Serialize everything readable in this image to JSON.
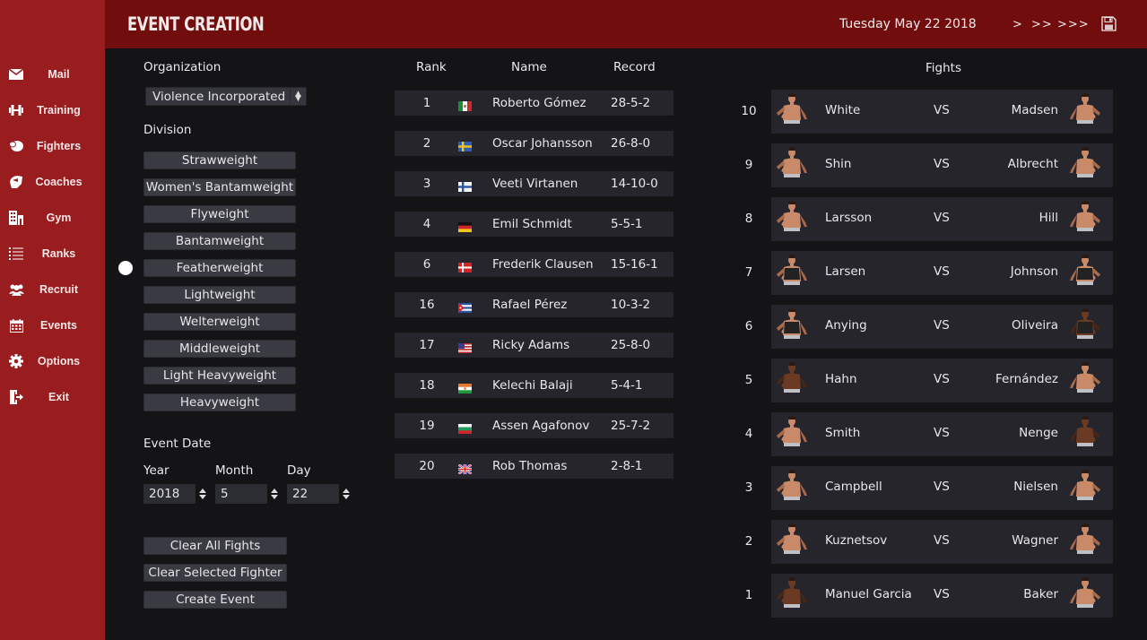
{
  "header": {
    "title": "Event Creation",
    "date": "Tuesday May 22 2018",
    "advance": [
      ">",
      ">>",
      ">>>"
    ],
    "save_icon": "floppy-disk-icon"
  },
  "sidebar": {
    "items": [
      {
        "label": "Mail",
        "icon": "envelope-icon"
      },
      {
        "label": "Training",
        "icon": "dumbbell-icon"
      },
      {
        "label": "Fighters",
        "icon": "boxing-glove-icon"
      },
      {
        "label": "Coaches",
        "icon": "whistle-icon"
      },
      {
        "label": "Gym",
        "icon": "building-icon"
      },
      {
        "label": "Ranks",
        "icon": "list-icon"
      },
      {
        "label": "Recruit",
        "icon": "users-icon"
      },
      {
        "label": "Events",
        "icon": "calendar-icon"
      },
      {
        "label": "Options",
        "icon": "gear-icon"
      },
      {
        "label": "Exit",
        "icon": "exit-door-icon"
      }
    ]
  },
  "left": {
    "organization_label": "Organization",
    "organization_value": "Violence Incorporated",
    "division_label": "Division",
    "divisions": [
      "Strawweight",
      "Women's Bantamweight",
      "Flyweight",
      "Bantamweight",
      "Featherweight",
      "Lightweight",
      "Welterweight",
      "Middleweight",
      "Light Heavyweight",
      "Heavyweight"
    ],
    "selected_division": "Featherweight",
    "event_date_label": "Event Date",
    "year_label": "Year",
    "month_label": "Month",
    "day_label": "Day",
    "year": "2018",
    "month": "5",
    "day": "22",
    "buttons": {
      "clear_all": "Clear All Fights",
      "clear_selected": "Clear Selected Fighter",
      "create": "Create Event"
    }
  },
  "ranks": {
    "headers": {
      "rank": "Rank",
      "name": "Name",
      "record": "Record"
    },
    "rows": [
      {
        "rank": "1",
        "country": "Mexico",
        "name": "Roberto Gómez",
        "record": "28-5-2"
      },
      {
        "rank": "2",
        "country": "Sweden",
        "name": "Oscar Johansson",
        "record": "26-8-0"
      },
      {
        "rank": "3",
        "country": "Finland",
        "name": "Veeti Virtanen",
        "record": "14-10-0"
      },
      {
        "rank": "4",
        "country": "Germany",
        "name": "Emil Schmidt",
        "record": "5-5-1"
      },
      {
        "rank": "6",
        "country": "Denmark",
        "name": "Frederik Clausen",
        "record": "15-16-1"
      },
      {
        "rank": "16",
        "country": "Cuba",
        "name": "Rafael Pérez",
        "record": "10-3-2"
      },
      {
        "rank": "17",
        "country": "United States",
        "name": "Ricky Adams",
        "record": "25-8-0"
      },
      {
        "rank": "18",
        "country": "Niger",
        "name": "Kelechi Balaji",
        "record": "5-4-1"
      },
      {
        "rank": "19",
        "country": "Bulgaria",
        "name": "Assen Agafonov",
        "record": "25-7-2"
      },
      {
        "rank": "20",
        "country": "United Kingdom",
        "name": "Rob Thomas",
        "record": "2-8-1"
      }
    ]
  },
  "fights": {
    "title": "Fights",
    "vs_label": "VS",
    "rows": [
      {
        "num": "10",
        "left": "White",
        "right": "Madsen",
        "left_skin": "light",
        "right_skin": "light",
        "left_f": false,
        "right_f": false
      },
      {
        "num": "9",
        "left": "Shin",
        "right": "Albrecht",
        "left_skin": "light",
        "right_skin": "light",
        "left_f": false,
        "right_f": false
      },
      {
        "num": "8",
        "left": "Larsson",
        "right": "Hill",
        "left_skin": "light",
        "right_skin": "light",
        "left_f": false,
        "right_f": false
      },
      {
        "num": "7",
        "left": "Larsen",
        "right": "Johnson",
        "left_skin": "light",
        "right_skin": "light",
        "left_f": true,
        "right_f": true
      },
      {
        "num": "6",
        "left": "Anying",
        "right": "Oliveira",
        "left_skin": "light",
        "right_skin": "dark",
        "left_f": true,
        "right_f": true
      },
      {
        "num": "5",
        "left": "Hahn",
        "right": "Fernández",
        "left_skin": "dark",
        "right_skin": "light",
        "left_f": false,
        "right_f": false
      },
      {
        "num": "4",
        "left": "Smith",
        "right": "Nenge",
        "left_skin": "light",
        "right_skin": "dark",
        "left_f": false,
        "right_f": false
      },
      {
        "num": "3",
        "left": "Campbell",
        "right": "Nielsen",
        "left_skin": "light",
        "right_skin": "light",
        "left_f": false,
        "right_f": false
      },
      {
        "num": "2",
        "left": "Kuznetsov",
        "right": "Wagner",
        "left_skin": "light",
        "right_skin": "light",
        "left_f": false,
        "right_f": false
      },
      {
        "num": "1",
        "left": "Manuel Garcia",
        "right": "Baker",
        "left_skin": "dark",
        "right_skin": "light",
        "left_f": false,
        "right_f": false
      }
    ]
  },
  "colors": {
    "sidebar": "#991d1f",
    "header": "#720d0e",
    "background": "#141416",
    "row": "#25252b",
    "button": "#3a3a42"
  }
}
